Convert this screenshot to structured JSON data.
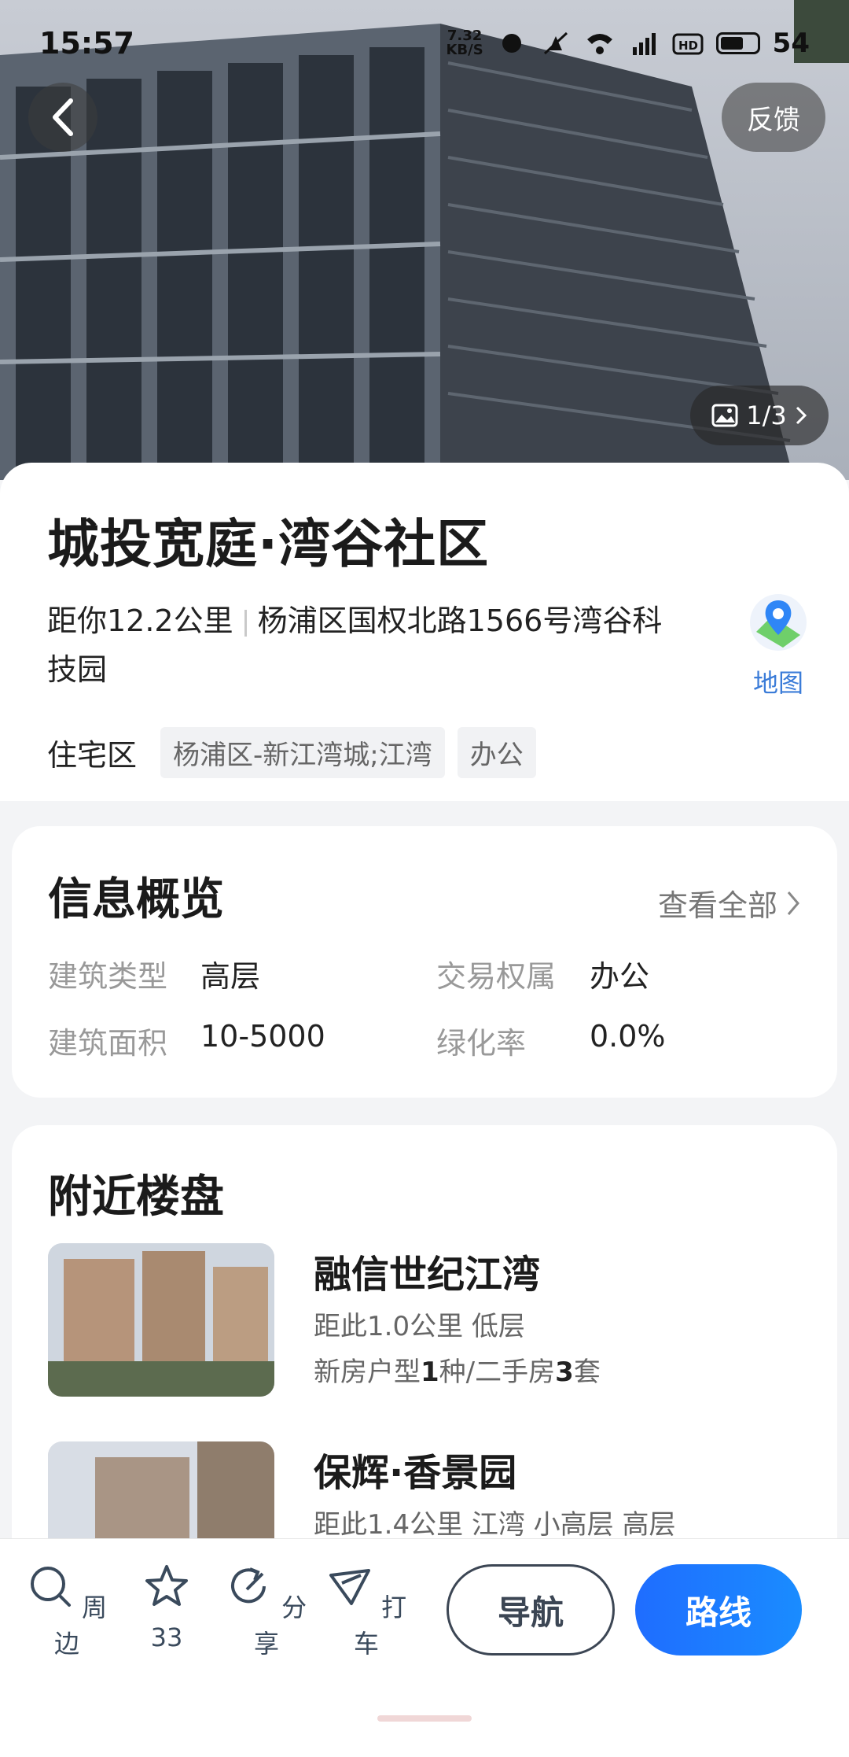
{
  "status_bar": {
    "time": "15:57",
    "net_speed_value": "7.32",
    "net_speed_unit": "KB/S",
    "battery": "54",
    "icons": [
      "notification-icon",
      "mute-icon",
      "wifi-icon",
      "4g-signal-icon",
      "hd-icon",
      "battery-icon"
    ]
  },
  "header": {
    "feedback_label": "反馈",
    "photo_counter": "1/3"
  },
  "place": {
    "title": "城投宽庭·湾谷社区",
    "distance": "距你12.2公里",
    "address": "杨浦区国权北路1566号湾谷科技园",
    "map_label": "地图",
    "category": "住宅区",
    "tags": [
      "杨浦区-新江湾城;江湾",
      "办公"
    ]
  },
  "overview": {
    "title": "信息概览",
    "see_all": "查看全部",
    "rows": [
      {
        "key1": "建筑类型",
        "val1": "高层",
        "key2": "交易权属",
        "val2": "办公"
      },
      {
        "key1": "建筑面积",
        "val1": "10-5000",
        "key2": "绿化率",
        "val2": "0.0%"
      }
    ]
  },
  "nearby": {
    "title": "附近楼盘",
    "items": [
      {
        "name": "融信世纪江湾",
        "meta": "距此1.0公里 低层",
        "new_label": "新房户型",
        "new_count": "1",
        "new_unit": "种/二手房",
        "used_count": "3",
        "used_unit": "套"
      },
      {
        "name": "保辉·香景园",
        "meta": "距此1.4公里 江湾 小高层 高层"
      }
    ]
  },
  "bottom_bar": {
    "tools": [
      {
        "label": "周边",
        "icon": "search-icon"
      },
      {
        "label": "33",
        "icon": "star-icon"
      },
      {
        "label": "分享",
        "icon": "share-icon"
      },
      {
        "label": "打车",
        "icon": "taxi-icon"
      }
    ],
    "nav_label": "导航",
    "route_label": "路线"
  },
  "colors": {
    "accent": "#1f6dff",
    "map_blue": "#3b7cd8"
  }
}
